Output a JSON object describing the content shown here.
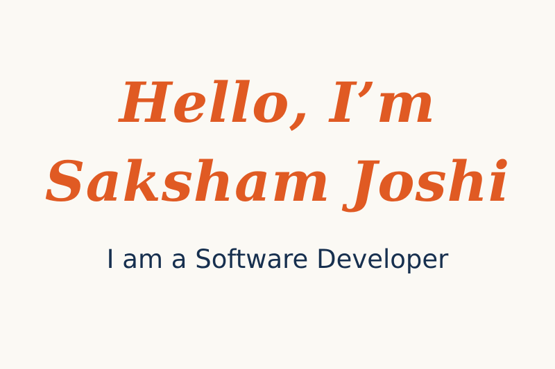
{
  "headline": {
    "line1": "Hello, I’m",
    "line2": "Saksham Joshi"
  },
  "subtitle": "I am a Software Developer",
  "colors": {
    "background": "#fbf9f4",
    "headline": "#e05a23",
    "subtitle": "#17304f"
  }
}
